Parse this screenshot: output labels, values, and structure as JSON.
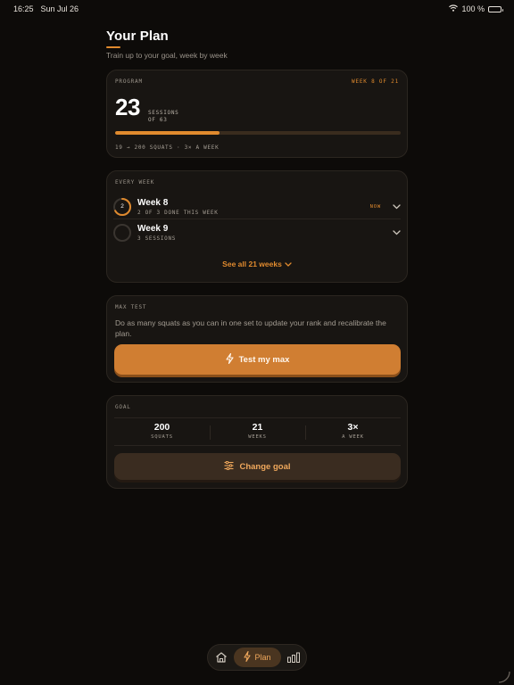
{
  "status_bar": {
    "time": "16:25",
    "date": "Sun Jul 26",
    "battery": "100 %"
  },
  "header": {
    "title": "Your Plan",
    "subtitle": "Train up to your goal, week by week"
  },
  "program": {
    "label": "PROGRAM",
    "week_badge": "WEEK 8 OF 21",
    "sessions_done": "23",
    "sessions_label_1": "SESSIONS",
    "sessions_label_2": "OF 63",
    "progress_fraction": 0.365,
    "summary": "19 → 200 SQUATS · 3× A WEEK"
  },
  "weeks": {
    "label": "EVERY WEEK",
    "items": [
      {
        "title": "Week 8",
        "subtitle": "2 OF 3 DONE THIS WEEK",
        "ring_value": "2",
        "badge": "NOW",
        "completion": 0.667
      },
      {
        "title": "Week 9",
        "subtitle": "3 SESSIONS",
        "ring_value": "",
        "badge": "",
        "completion": 0
      }
    ],
    "see_all": "See all 21 weeks"
  },
  "max_test": {
    "label": "MAX TEST",
    "description": "Do as many squats as you can in one set to update your rank and recalibrate the plan.",
    "button_label": "Test my max"
  },
  "goal": {
    "label": "GOAL",
    "stats": [
      {
        "value": "200",
        "unit": "SQUATS"
      },
      {
        "value": "21",
        "unit": "WEEKS"
      },
      {
        "value": "3×",
        "unit": "A WEEK"
      }
    ],
    "button_label": "Change goal"
  },
  "tab_bar": {
    "active_label": "Plan"
  },
  "colors": {
    "accent": "#e08a2e",
    "background": "#0d0b09",
    "card": "#181512"
  }
}
